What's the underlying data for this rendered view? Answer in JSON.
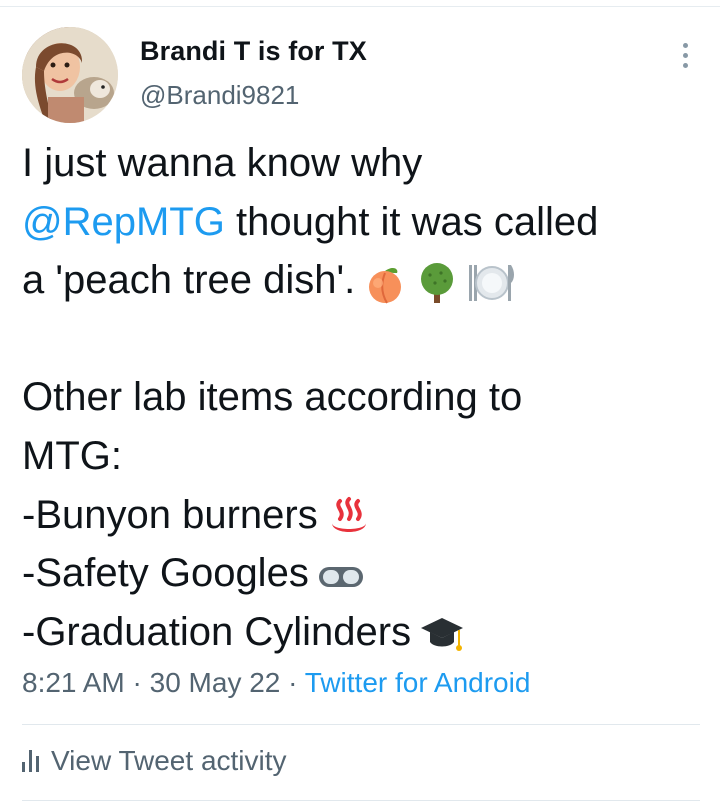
{
  "user": {
    "display_name": "Brandi T is for TX",
    "handle": "@Brandi9821"
  },
  "tweet": {
    "line1": "I just wanna know why",
    "mention": "@RepMTG",
    "line2_rest": " thought it was called",
    "line3": "a 'peach tree dish'.",
    "line5": "Other lab items according to",
    "line6": "MTG:",
    "item1": "-Bunyon burners",
    "item2": "-Safety Googles",
    "item3": "-Graduation Cylinders",
    "emojis": [
      "peach-emoji",
      "deciduous-tree-emoji",
      "fork-knife-plate-emoji",
      "hot-springs-emoji",
      "goggles-emoji",
      "graduation-cap-emoji"
    ]
  },
  "meta": {
    "time": "8:21 AM",
    "date": "30 May 22",
    "separator": " · ",
    "source": "Twitter for Android"
  },
  "activity": {
    "label": "View Tweet activity"
  },
  "colors": {
    "accent": "#1d9bf0",
    "secondary_text": "#536471",
    "divider": "#e1e8ed"
  }
}
